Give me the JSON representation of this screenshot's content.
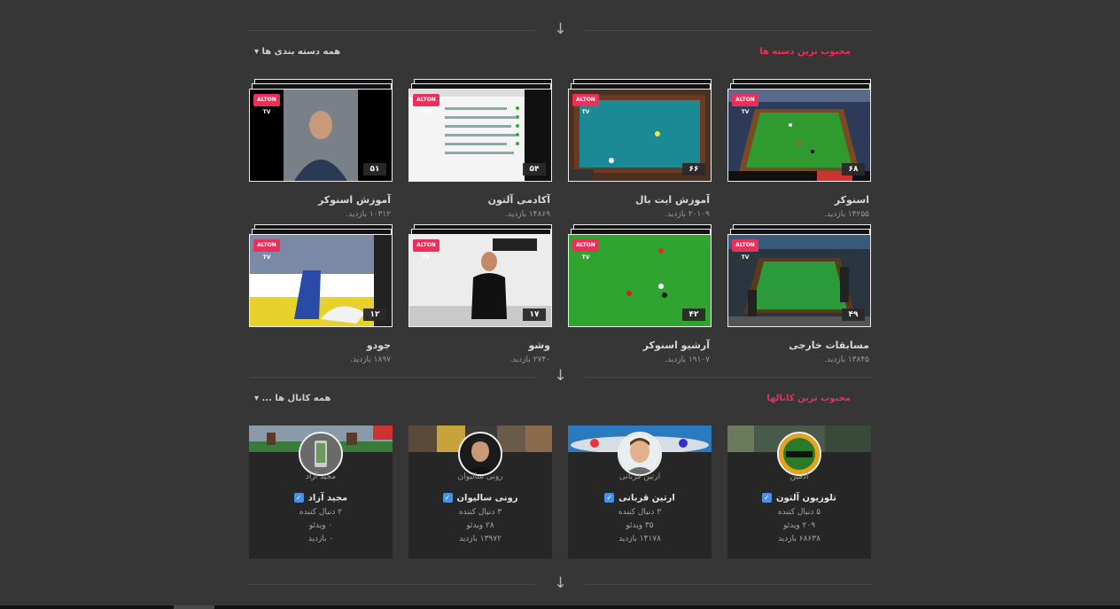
{
  "sections": {
    "categories": {
      "title": "محبوب ترین دسته ها",
      "link": "همه دسته بندی ها ▾"
    },
    "channels": {
      "title": "محبوب ترین کانالها",
      "link": "همه کانال ها ... ▾"
    }
  },
  "icons": {
    "arrow_down": "↓",
    "check": "✓"
  },
  "colors": {
    "accent": "#e8305a",
    "verified": "#4a8fe0",
    "background": "#363636"
  },
  "logo_text": "ALTON TV",
  "categories": [
    {
      "name": "اسنوکر",
      "views": "۱۴۲۵۵ بازدید.",
      "count": "۶۸"
    },
    {
      "name": "آموزش ایت بال",
      "views": "۲۰۱۰۹ بازدید.",
      "count": "۶۶"
    },
    {
      "name": "آکادمی آلتون",
      "views": "۱۴۸۶۹ بازدید.",
      "count": "۵۴"
    },
    {
      "name": "آموزش اسنوکر",
      "views": "۱۰۳۱۲ بازدید.",
      "count": "۵۱"
    },
    {
      "name": "مسابقات خارجی",
      "views": "۱۳۸۴۵ بازدید.",
      "count": "۴۹"
    },
    {
      "name": "آرشیو اسنوکر",
      "views": "۱۹۱۰۷ بازدید.",
      "count": "۴۲"
    },
    {
      "name": "وشو",
      "views": "۲۷۴۰ بازدید.",
      "count": "۱۷"
    },
    {
      "name": "جودو",
      "views": "۱۸۹۷ بازدید.",
      "count": "۱۲"
    }
  ],
  "channels": [
    {
      "user": "ادمین",
      "name": "تلوزیون آلتون",
      "followers": "۵ دنبال کننده",
      "videos": "۲۰۹ ویدئو",
      "views": "۶۸۶۳۸ بازدید"
    },
    {
      "user": "ارتین قربانی",
      "name": "ارتین قربانی",
      "followers": "۳ دنبال کننده",
      "videos": "۳۵ ویدئو",
      "views": "۱۴۱۷۸ بازدید"
    },
    {
      "user": "رونی سالیوان",
      "name": "رونی سالیوان",
      "followers": "۳ دنبال کننده",
      "videos": "۲۸ ویدئو",
      "views": "۱۳۹۷۲ بازدید"
    },
    {
      "user": "مجید آزاد",
      "name": "مجید آزاد",
      "followers": "۲ دنبال کننده",
      "videos": "۰ ویدئو",
      "views": "۰ بازدید"
    }
  ]
}
